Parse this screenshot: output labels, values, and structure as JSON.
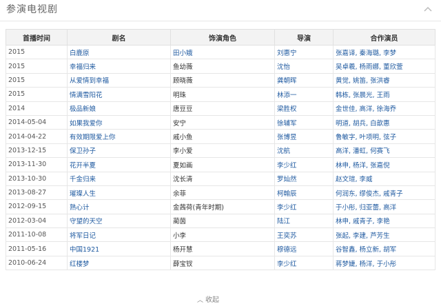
{
  "section": {
    "title": "参演电视剧"
  },
  "table": {
    "headers": [
      "首播时间",
      "剧名",
      "饰演角色",
      "导演",
      "合作演员"
    ],
    "rows": [
      {
        "date": "2015",
        "title": "白鹿原",
        "role": "田小娥",
        "role_link": true,
        "director": "刘惠宁",
        "cast": "张嘉译, 秦海璐, 李梦"
      },
      {
        "date": "2015",
        "title": "幸福归来",
        "role": "鱼幼薇",
        "role_link": false,
        "director": "沈怡",
        "cast": "吴卓羲, 杨雨娜, 董欣萱"
      },
      {
        "date": "2015",
        "title": "从爱情到幸福",
        "role": "顾晓薇",
        "role_link": false,
        "director": "龚朝晖",
        "cast": "黄觉, 姚笛, 张洪睿"
      },
      {
        "date": "2015",
        "title": "情满雪阳花",
        "role": "明珠",
        "role_link": false,
        "director": "林添一",
        "cast": "韩栋, 张晨光, 王雨"
      },
      {
        "date": "2014",
        "title": "极品新娘",
        "role": "唐豆豆",
        "role_link": false,
        "director": "梁胜权",
        "cast": "金世佳, 高洋, 徐海乔"
      },
      {
        "date": "2014-05-04",
        "title": "如果我爱你",
        "role": "安宁",
        "role_link": false,
        "director": "徐辅军",
        "cast": "明道, 胡兵, 白歆惠"
      },
      {
        "date": "2014-04-22",
        "title": "有效期限爱上你",
        "role": "戚小鱼",
        "role_link": false,
        "director": "张博昱",
        "cast": "鲁敏字, 叶项明, 弦子"
      },
      {
        "date": "2013-12-15",
        "title": "保卫孙子",
        "role": "李小爱",
        "role_link": false,
        "director": "沈航",
        "cast": "高洋, 潘虹, 何赛飞"
      },
      {
        "date": "2013-11-30",
        "title": "花开半夏",
        "role": "夏如画",
        "role_link": false,
        "director": "李少红",
        "cast": "林申, 杨洋, 张嘉倪"
      },
      {
        "date": "2013-10-30",
        "title": "千金归来",
        "role": "沈长清",
        "role_link": false,
        "director": "罗灿然",
        "cast": "赵文瑄, 李威"
      },
      {
        "date": "2013-08-27",
        "title": "璀璨人生",
        "role": "余菲",
        "role_link": false,
        "director": "柯翰辰",
        "cast": "何润东, 缪俊杰, 戚青子"
      },
      {
        "date": "2012-09-15",
        "title": "熟心计",
        "role": "金茜荷(青年时期)",
        "role_link": false,
        "director": "李少红",
        "cast": "于小彤, 归亚蕾, 高洋"
      },
      {
        "date": "2012-03-04",
        "title": "守望的天空",
        "role": "蔺茵",
        "role_link": false,
        "director": "陆江",
        "cast": "林申, 戚青子, 李艳"
      },
      {
        "date": "2011-10-08",
        "title": "将军日记",
        "role": "小李",
        "role_link": false,
        "director": "王奕苏",
        "cast": "张起, 李建, 芦芳生"
      },
      {
        "date": "2011-05-16",
        "title": "中国1921",
        "role": "杨开慧",
        "role_link": false,
        "director": "穆德远",
        "cast": "谷智鑫, 杨立新, 胡军"
      },
      {
        "date": "2010-06-24",
        "title": "红楼梦",
        "role": "薛宝钗",
        "role_link": false,
        "director": "李少红",
        "cast": "蒋梦婕, 杨洋, 于小彤"
      }
    ]
  },
  "footer": {
    "collapse_label": "收起"
  }
}
